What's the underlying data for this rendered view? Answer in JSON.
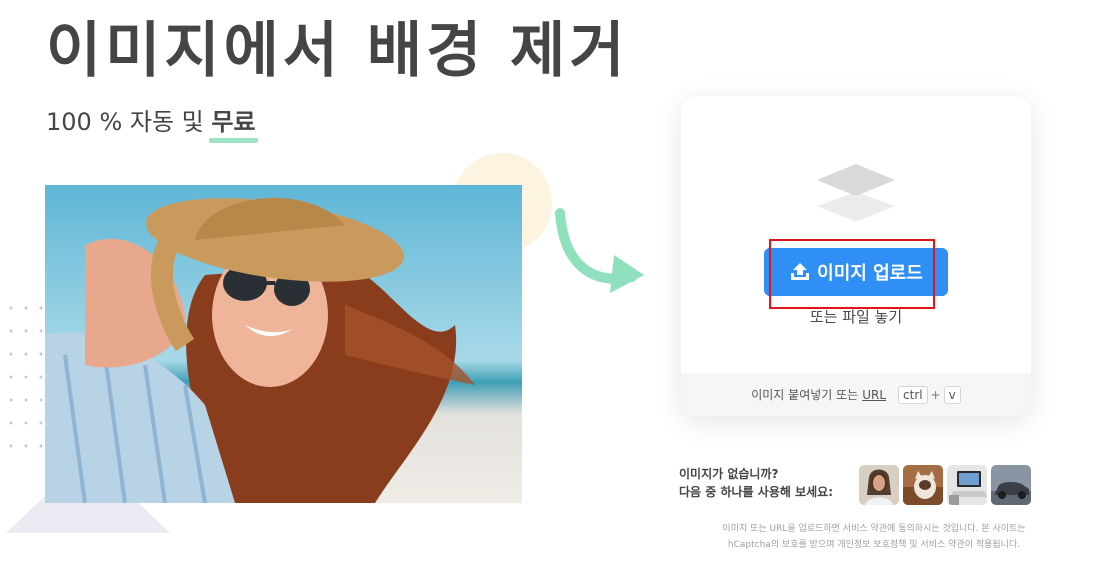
{
  "hero": {
    "title": "이미지에서 배경 제거",
    "subtitle_prefix": "100 % 자동 및",
    "subtitle_free": "무료"
  },
  "upload": {
    "button_label": "이미지 업로드",
    "drop_text": "또는 파일 놓기",
    "paste_text": "이미지 붙여넣기 또는",
    "url_link": "URL",
    "key_ctrl": "ctrl",
    "key_plus": "+",
    "key_v": "v"
  },
  "samples": {
    "line1": "이미지가 없습니까?",
    "line2": "다음 중 하나를 사용해 보세요:",
    "items": [
      "woman",
      "cat",
      "laptop",
      "car"
    ]
  },
  "legal": {
    "line1": "이미지 또는 URL을 업로드하면 서비스 약관에 동의하시는 것입니다. 본 사이트는",
    "line2": "hCaptcha의 보호를 받으며 개인정보 보호정책 및 서비스 약관이 적용됩니다."
  },
  "colors": {
    "accent": "#2f8ff5",
    "highlight": "#e0141c",
    "underline": "#9fe3c6",
    "arrow": "#8fe0bd"
  }
}
